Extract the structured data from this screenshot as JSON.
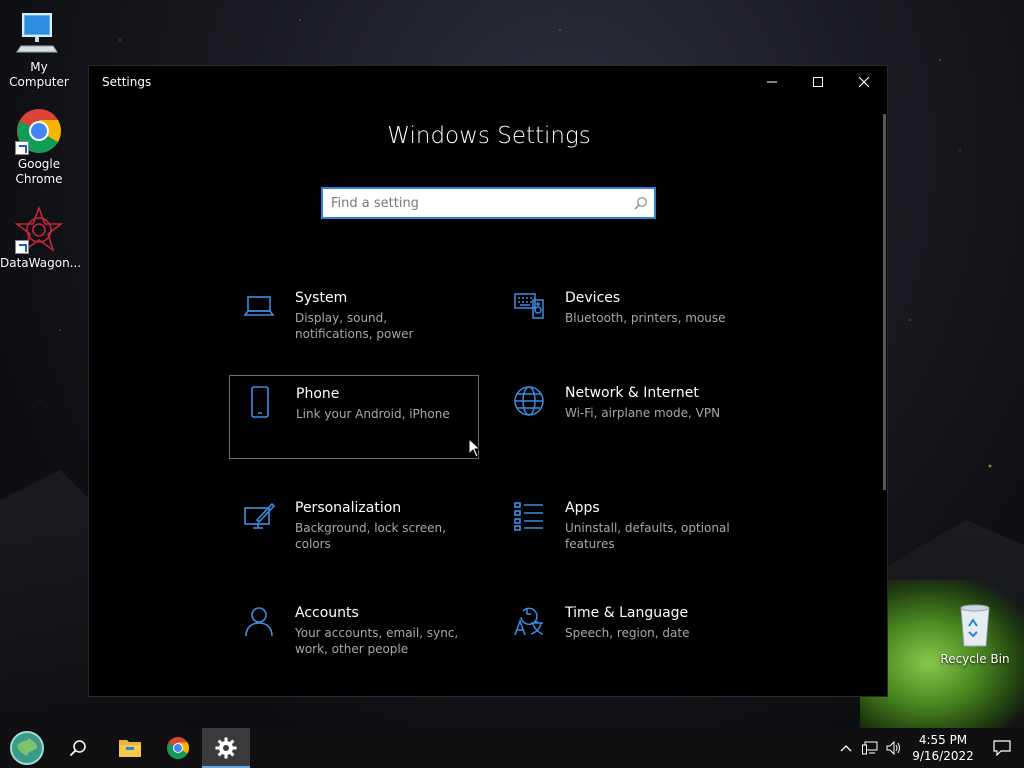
{
  "desktop": {
    "icons": [
      {
        "label": "My Computer",
        "icon": "monitor-icon"
      },
      {
        "label": "Google Chrome",
        "icon": "chrome-icon"
      },
      {
        "label": "DataWagon...",
        "icon": "datawagon-icon"
      },
      {
        "label": "Recycle Bin",
        "icon": "recycle-bin-icon"
      }
    ]
  },
  "window": {
    "title": "Settings",
    "controls": {
      "minimize": "minimize-icon",
      "maximize": "maximize-icon",
      "close": "close-icon"
    }
  },
  "settings": {
    "page_title": "Windows Settings",
    "search": {
      "placeholder": "Find a setting",
      "value": ""
    },
    "tiles": [
      {
        "name": "System",
        "desc": "Display, sound, notifications, power",
        "icon": "laptop-icon"
      },
      {
        "name": "Devices",
        "desc": "Bluetooth, printers, mouse",
        "icon": "devices-icon"
      },
      {
        "name": "Phone",
        "desc": "Link your Android, iPhone",
        "icon": "phone-icon"
      },
      {
        "name": "Network & Internet",
        "desc": "Wi-Fi, airplane mode, VPN",
        "icon": "globe-icon"
      },
      {
        "name": "Personalization",
        "desc": "Background, lock screen, colors",
        "icon": "personalization-icon"
      },
      {
        "name": "Apps",
        "desc": "Uninstall, defaults, optional features",
        "icon": "apps-list-icon"
      },
      {
        "name": "Accounts",
        "desc": "Your accounts, email, sync, work, other people",
        "icon": "person-icon"
      },
      {
        "name": "Time & Language",
        "desc": "Speech, region, date",
        "icon": "time-language-icon"
      }
    ]
  },
  "taskbar": {
    "items": [
      "start-icon",
      "search-icon",
      "file-explorer-icon",
      "chrome-icon",
      "settings-gear-icon"
    ],
    "tray": {
      "icons": [
        "chevron-up-icon",
        "network-icon",
        "volume-icon"
      ],
      "time": "4:55 PM",
      "date": "9/16/2022"
    },
    "notification_icon": "notification-icon"
  },
  "colors": {
    "accent": "#2b86d9",
    "icon_blue": "#3a8ee6"
  }
}
